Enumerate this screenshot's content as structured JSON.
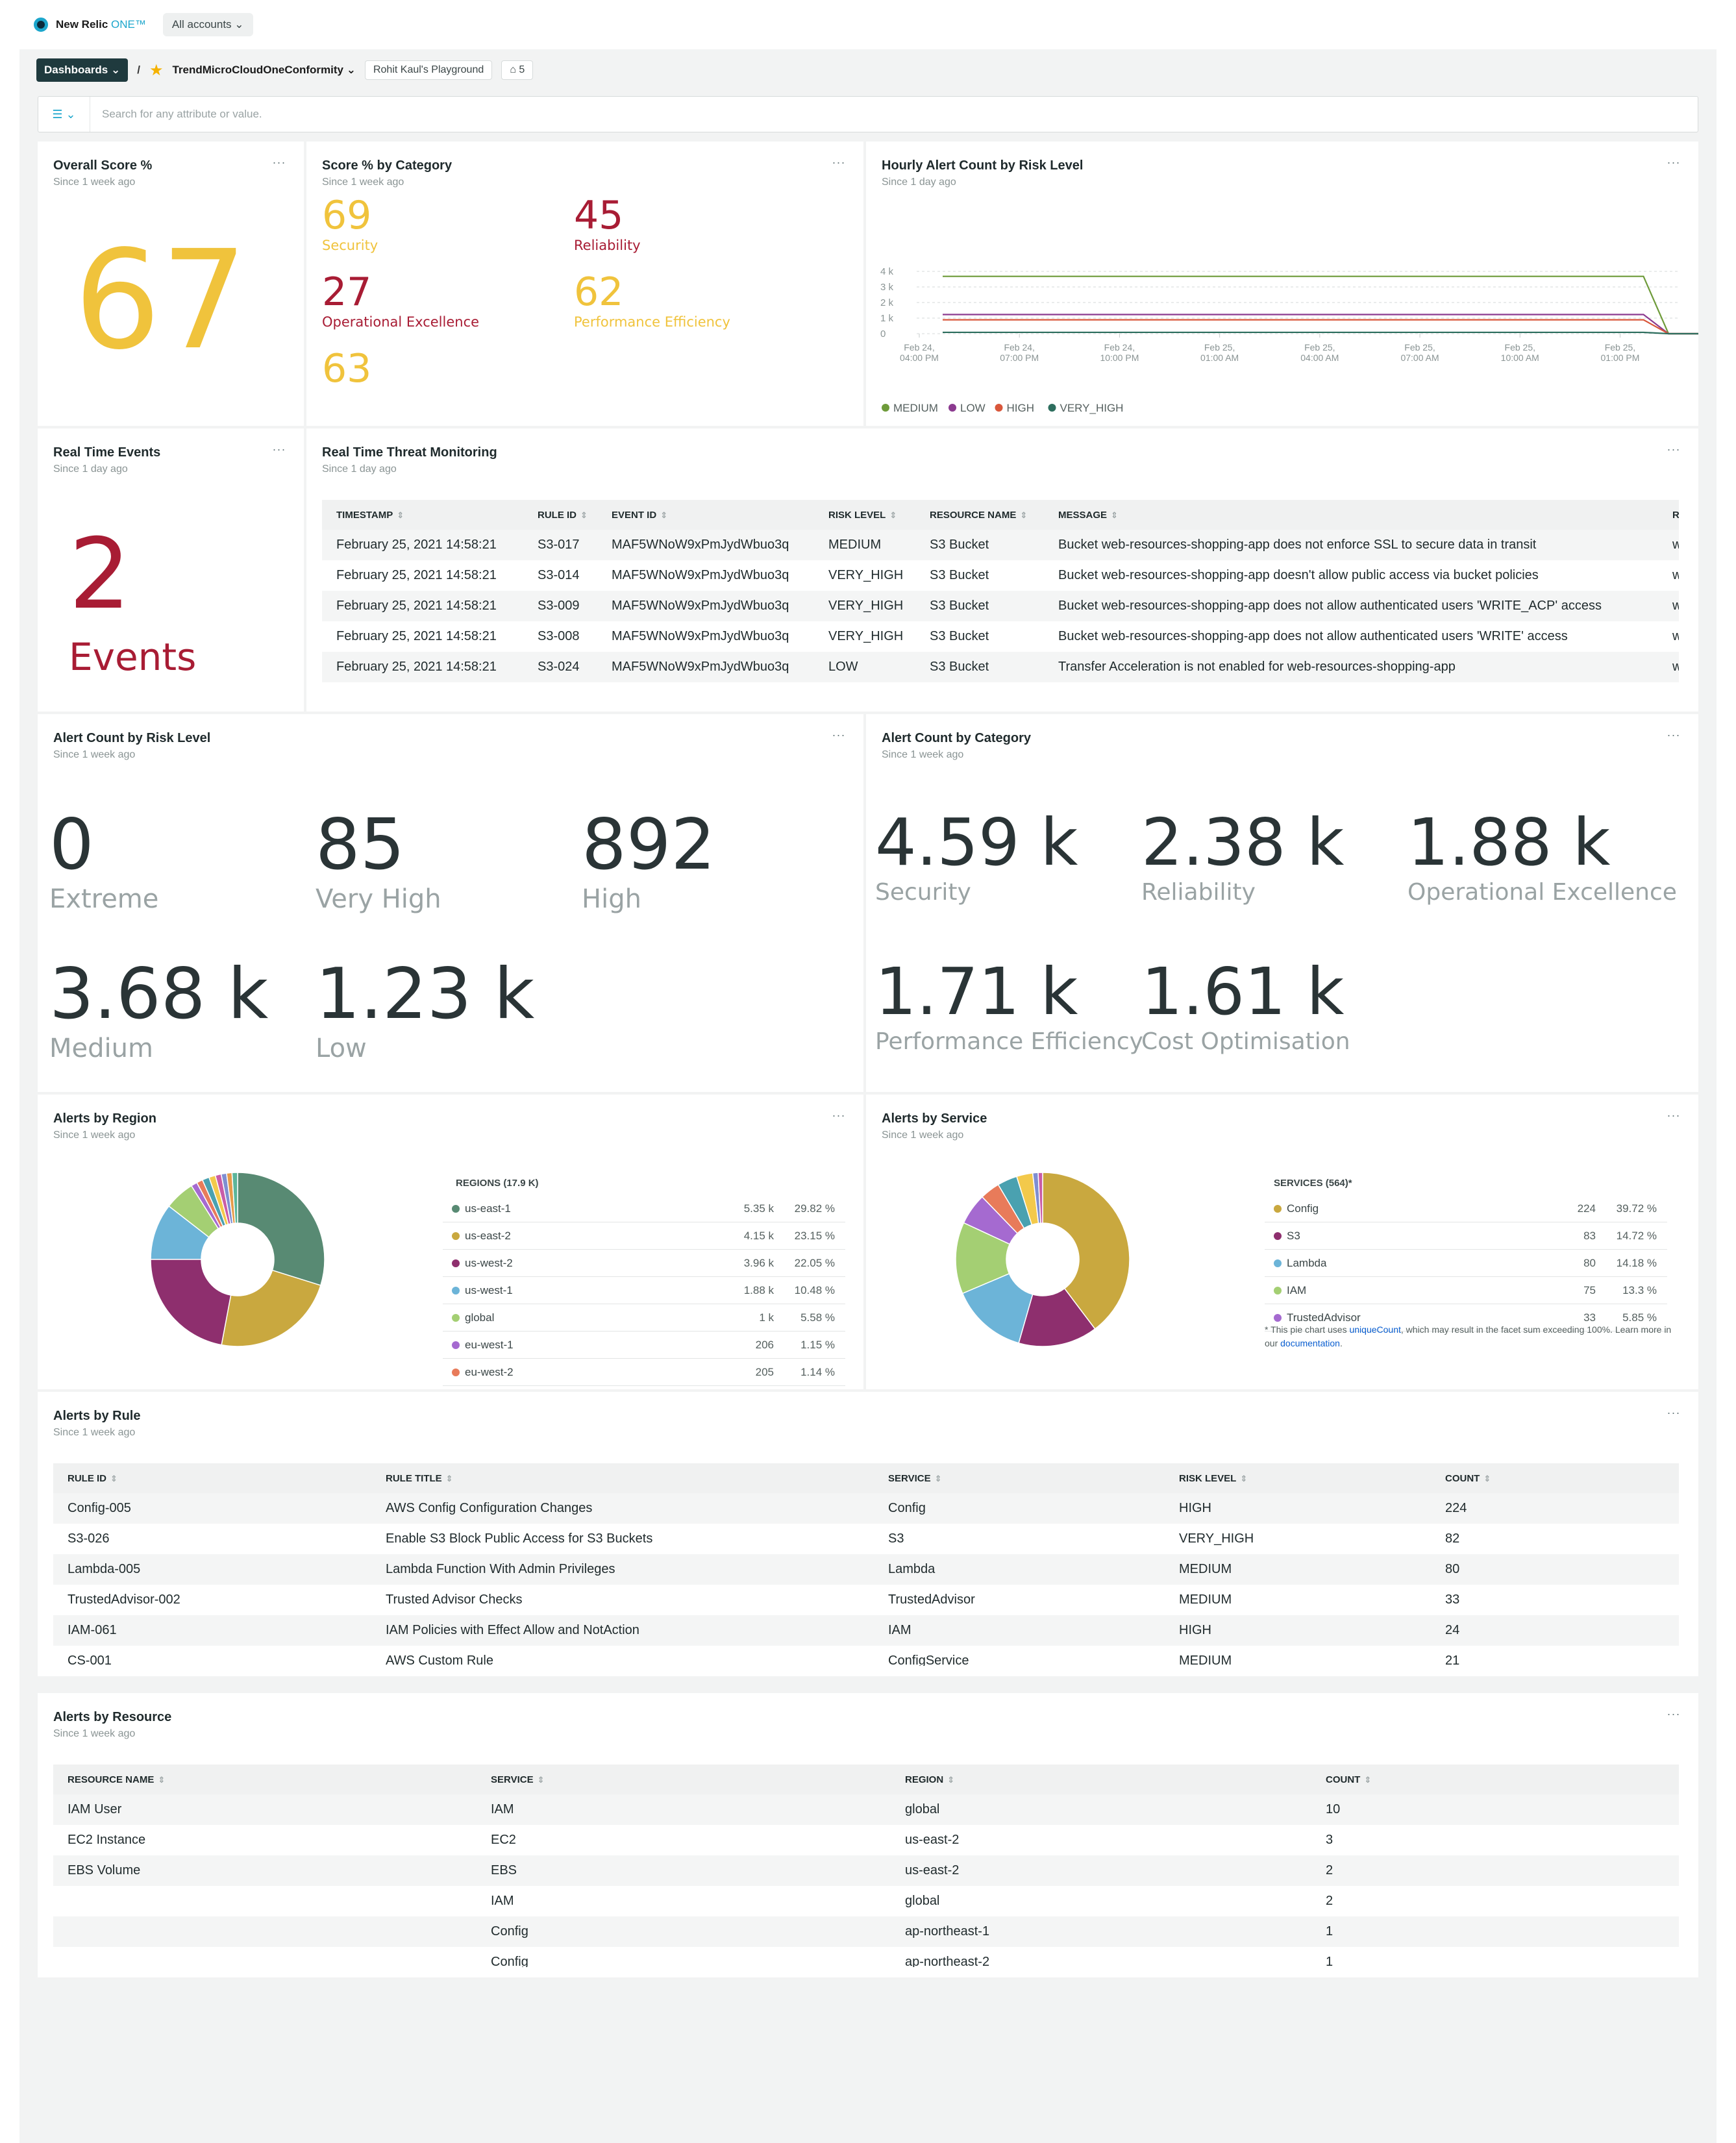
{
  "app": {
    "logo_text": "New Relic",
    "logo_one": "ONE™",
    "account_selector": "All accounts"
  },
  "breadcrumb": {
    "dashboards_label": "Dashboards",
    "separator": "/",
    "dashboard_name": "TrendMicroCloudOneConformity",
    "owner": "Rohit Kaul's Playground",
    "tag_count": "5"
  },
  "filter": {
    "placeholder": "Search for any attribute or value."
  },
  "overall_score": {
    "title": "Overall Score %",
    "subtitle": "Since 1 week ago",
    "value": "67",
    "color": "#f0c33c"
  },
  "score_by_category": {
    "title": "Score % by Category",
    "subtitle": "Since 1 week ago",
    "items": [
      {
        "value": "69",
        "label": "Security",
        "color": "#f0c33c"
      },
      {
        "value": "45",
        "label": "Reliability",
        "color": "#a81c34"
      },
      {
        "value": "27",
        "label": "Operational Excellence",
        "color": "#a81c34"
      },
      {
        "value": "62",
        "label": "Performance Efficiency",
        "color": "#f0c33c"
      },
      {
        "value": "63",
        "label": "",
        "color": "#f0c33c"
      }
    ]
  },
  "hourly_alert": {
    "title": "Hourly Alert Count by Risk Level",
    "subtitle": "Since 1 day ago"
  },
  "chart_data": {
    "type": "line",
    "title": "Hourly Alert Count by Risk Level",
    "yticks": [
      "4 k",
      "3 k",
      "2 k",
      "1 k",
      "0"
    ],
    "ylim": [
      0,
      4000
    ],
    "xticks": [
      [
        "Feb 24,",
        "04:00 PM"
      ],
      [
        "Feb 24,",
        "07:00 PM"
      ],
      [
        "Feb 24,",
        "10:00 PM"
      ],
      [
        "Feb 25,",
        "01:00 AM"
      ],
      [
        "Feb 25,",
        "04:00 AM"
      ],
      [
        "Feb 25,",
        "07:00 AM"
      ],
      [
        "Feb 25,",
        "10:00 AM"
      ],
      [
        "Feb 25,",
        "01:00 PM"
      ]
    ],
    "x": [
      0,
      1,
      2,
      3,
      4,
      5,
      6,
      7,
      7.25,
      7.6
    ],
    "series": [
      {
        "name": "MEDIUM",
        "color": "#6e9b3a",
        "values": [
          3680,
          3680,
          3680,
          3680,
          3680,
          3680,
          3680,
          3680,
          0,
          0
        ]
      },
      {
        "name": "LOW",
        "color": "#8b3a8f",
        "values": [
          1230,
          1230,
          1230,
          1230,
          1230,
          1230,
          1230,
          1230,
          0,
          0
        ]
      },
      {
        "name": "HIGH",
        "color": "#d9573b",
        "values": [
          890,
          890,
          890,
          890,
          890,
          890,
          890,
          890,
          0,
          0
        ]
      },
      {
        "name": "VERY_HIGH",
        "color": "#2d6e5e",
        "values": [
          85,
          85,
          85,
          85,
          85,
          85,
          85,
          85,
          0,
          0
        ]
      }
    ],
    "grid": true,
    "legend": "bottom"
  },
  "realtime_events": {
    "title": "Real Time Events",
    "subtitle": "Since 1 day ago",
    "value": "2",
    "label": "Events",
    "color": "#a81c34"
  },
  "threat_monitoring": {
    "title": "Real Time Threat Monitoring",
    "subtitle": "Since 1 day ago",
    "columns": [
      "TIMESTAMP",
      "RULE ID",
      "EVENT ID",
      "RISK LEVEL",
      "RESOURCE NAME",
      "MESSAGE",
      "RI"
    ],
    "rows": [
      [
        "February 25, 2021 14:58:21",
        "S3-017",
        "MAF5WNoW9xPmJydWbuo3q",
        "MEDIUM",
        "S3 Bucket",
        "Bucket web-resources-shopping-app does not enforce SSL to secure data in transit",
        "w"
      ],
      [
        "February 25, 2021 14:58:21",
        "S3-014",
        "MAF5WNoW9xPmJydWbuo3q",
        "VERY_HIGH",
        "S3 Bucket",
        "Bucket web-resources-shopping-app doesn't allow public access via bucket policies",
        "w"
      ],
      [
        "February 25, 2021 14:58:21",
        "S3-009",
        "MAF5WNoW9xPmJydWbuo3q",
        "VERY_HIGH",
        "S3 Bucket",
        "Bucket web-resources-shopping-app does not allow authenticated users 'WRITE_ACP' access",
        "w"
      ],
      [
        "February 25, 2021 14:58:21",
        "S3-008",
        "MAF5WNoW9xPmJydWbuo3q",
        "VERY_HIGH",
        "S3 Bucket",
        "Bucket web-resources-shopping-app does not allow authenticated users 'WRITE' access",
        "w"
      ],
      [
        "February 25, 2021 14:58:21",
        "S3-024",
        "MAF5WNoW9xPmJydWbuo3q",
        "LOW",
        "S3 Bucket",
        "Transfer Acceleration is not enabled for web-resources-shopping-app",
        "w"
      ]
    ]
  },
  "alert_by_risk": {
    "title": "Alert Count by Risk Level",
    "subtitle": "Since 1 week ago",
    "items": [
      {
        "value": "0",
        "label": "Extreme"
      },
      {
        "value": "85",
        "label": "Very High"
      },
      {
        "value": "892",
        "label": "High"
      },
      {
        "value": "3.68 k",
        "label": "Medium"
      },
      {
        "value": "1.23 k",
        "label": "Low"
      }
    ]
  },
  "alert_by_category": {
    "title": "Alert Count by Category",
    "subtitle": "Since 1 week ago",
    "items": [
      {
        "value": "4.59 k",
        "label": "Security"
      },
      {
        "value": "2.38 k",
        "label": "Reliability"
      },
      {
        "value": "1.88 k",
        "label": "Operational Excellence"
      },
      {
        "value": "1.71 k",
        "label": "Performance Efficiency"
      },
      {
        "value": "1.61 k",
        "label": "Cost Optimisation"
      }
    ]
  },
  "alerts_by_region": {
    "title": "Alerts by Region",
    "subtitle": "Since 1 week ago",
    "legend_title": "REGIONS (17.9 K)",
    "rows": [
      {
        "name": "us-east-1",
        "value": "5.35 k",
        "pct": "29.82 %",
        "color": "#588a73",
        "share": 29.82
      },
      {
        "name": "us-east-2",
        "value": "4.15 k",
        "pct": "23.15 %",
        "color": "#c9a83f",
        "share": 23.15
      },
      {
        "name": "us-west-2",
        "value": "3.96 k",
        "pct": "22.05 %",
        "color": "#8e2f6e",
        "share": 22.05
      },
      {
        "name": "us-west-1",
        "value": "1.88 k",
        "pct": "10.48 %",
        "color": "#6cb4d8",
        "share": 10.48
      },
      {
        "name": "global",
        "value": "1 k",
        "pct": "5.58 %",
        "color": "#a4cf73",
        "share": 5.58
      },
      {
        "name": "eu-west-1",
        "value": "206",
        "pct": "1.15 %",
        "color": "#a56ad0",
        "share": 1.15
      },
      {
        "name": "eu-west-2",
        "value": "205",
        "pct": "1.14 %",
        "color": "#e87b5a",
        "share": 1.14
      }
    ],
    "other_slices": [
      {
        "color": "#4aa1b0",
        "share": 1.3
      },
      {
        "color": "#f3c94b",
        "share": 1.2
      },
      {
        "color": "#c95ca7",
        "share": 1.1
      },
      {
        "color": "#7f8ed1",
        "share": 1.0
      },
      {
        "color": "#e79b4a",
        "share": 1.0
      },
      {
        "color": "#5cb59a",
        "share": 1.03
      }
    ]
  },
  "alerts_by_service": {
    "title": "Alerts by Service",
    "subtitle": "Since 1 week ago",
    "legend_title": "SERVICES (564)*",
    "rows": [
      {
        "name": "Config",
        "value": "224",
        "pct": "39.72 %",
        "color": "#c9a83f",
        "share": 39.72
      },
      {
        "name": "S3",
        "value": "83",
        "pct": "14.72 %",
        "color": "#8e2f6e",
        "share": 14.72
      },
      {
        "name": "Lambda",
        "value": "80",
        "pct": "14.18 %",
        "color": "#6cb4d8",
        "share": 14.18
      },
      {
        "name": "IAM",
        "value": "75",
        "pct": "13.3 %",
        "color": "#a4cf73",
        "share": 13.3
      },
      {
        "name": "TrustedAdvisor",
        "value": "33",
        "pct": "5.85 %",
        "color": "#a56ad0",
        "share": 5.85
      }
    ],
    "other_slices": [
      {
        "color": "#e87b5a",
        "share": 3.7
      },
      {
        "color": "#4aa1b0",
        "share": 3.7
      },
      {
        "color": "#f3c94b",
        "share": 3.0
      },
      {
        "color": "#7f8ed1",
        "share": 1.0
      },
      {
        "color": "#c95ca7",
        "share": 0.83
      }
    ],
    "footnote_pre": "* This pie chart uses ",
    "footnote_link": "uniqueCount",
    "footnote_mid": ", which may result in the facet sum exceeding 100%. Learn more in our ",
    "footnote_link2": "documentation",
    "footnote_post": "."
  },
  "alerts_by_rule": {
    "title": "Alerts by Rule",
    "subtitle": "Since 1 week ago",
    "columns": [
      "RULE ID",
      "RULE TITLE",
      "SERVICE",
      "RISK LEVEL",
      "COUNT"
    ],
    "rows": [
      [
        "Config-005",
        "AWS Config Configuration Changes",
        "Config",
        "HIGH",
        "224"
      ],
      [
        "S3-026",
        "Enable S3 Block Public Access for S3 Buckets",
        "S3",
        "VERY_HIGH",
        "82"
      ],
      [
        "Lambda-005",
        "Lambda Function With Admin Privileges",
        "Lambda",
        "MEDIUM",
        "80"
      ],
      [
        "TrustedAdvisor-002",
        "Trusted Advisor Checks",
        "TrustedAdvisor",
        "MEDIUM",
        "33"
      ],
      [
        "IAM-061",
        "IAM Policies with Effect Allow and NotAction",
        "IAM",
        "HIGH",
        "24"
      ],
      [
        "CS-001",
        "AWS Custom Rule",
        "ConfigService",
        "MEDIUM",
        "21"
      ]
    ]
  },
  "alerts_by_resource": {
    "title": "Alerts by Resource",
    "subtitle": "Since 1 week ago",
    "columns": [
      "RESOURCE NAME",
      "SERVICE",
      "REGION",
      "COUNT"
    ],
    "rows": [
      [
        "IAM User",
        "IAM",
        "global",
        "10"
      ],
      [
        "EC2 Instance",
        "EC2",
        "us-east-2",
        "3"
      ],
      [
        "EBS Volume",
        "EBS",
        "us-east-2",
        "2"
      ],
      [
        "",
        "IAM",
        "global",
        "2"
      ],
      [
        "",
        "Config",
        "ap-northeast-1",
        "1"
      ],
      [
        "",
        "Config",
        "ap-northeast-2",
        "1"
      ]
    ]
  },
  "common": {
    "more_menu": "···",
    "sort_icon": "⇕"
  }
}
